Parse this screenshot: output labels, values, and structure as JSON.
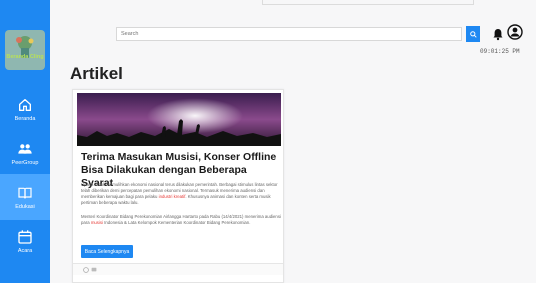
{
  "sidebar": {
    "logo_text": "Beranda Cling",
    "items": [
      {
        "label": "Beranda",
        "icon": "home-icon",
        "active": false
      },
      {
        "label": "PeerGroup",
        "icon": "group-icon",
        "active": false
      },
      {
        "label": "Edukasi",
        "icon": "book-icon",
        "active": true
      },
      {
        "label": "Acara",
        "icon": "calendar-icon",
        "active": false
      }
    ]
  },
  "header": {
    "search_placeholder": "Search",
    "clock": "09:01:25 PM"
  },
  "page": {
    "title": "Artikel"
  },
  "article": {
    "title": "Terima Masukan Musisi, Konser Offline Bisa Dilakukan dengan Beberapa Syarat",
    "p1_a": "Upaya untuk memulihkan ekonomi nasional terus dilakukan pemerintah. Berbagai stimulus lintas sektor telah diberikan demi percepatan pemulihan ekonomi nasional. Termasuk menerima audiensi dan memberikan kemajuan bagi para pelaku",
    "p1_link": "industri kreatif",
    "p1_b": ". Khususnya animasi dan konten serta musik pertiman beberapa waktu lalu.",
    "p2_a": "Menteri Koordinator Bidang Perekonomian Airlangga Hartarto pada Rabu (14/4/2021) menerima audiensi para",
    "p2_link": "musisi",
    "p2_b": "Indonesia & Lata Kelompok Kementerian Koordinator Bidang Perekonomian.",
    "button_label": "Baca Selengkapnya"
  },
  "colors": {
    "sidebar": "#1e88f2",
    "sidebar_active": "#4aa6ff",
    "accent": "#1e88f2",
    "link": "#e53935"
  }
}
